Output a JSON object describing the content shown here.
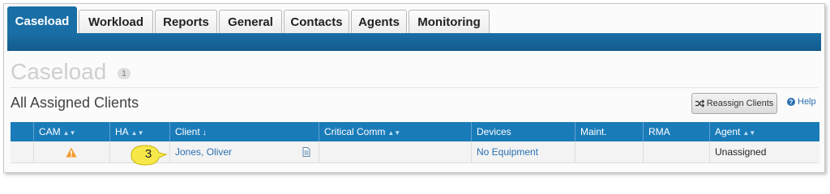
{
  "tabs": [
    {
      "label": "Caseload",
      "active": true
    },
    {
      "label": "Workload",
      "active": false
    },
    {
      "label": "Reports",
      "active": false
    },
    {
      "label": "General",
      "active": false
    },
    {
      "label": "Contacts",
      "active": false
    },
    {
      "label": "Agents",
      "active": false
    },
    {
      "label": "Monitoring",
      "active": false
    }
  ],
  "page": {
    "title": "Caseload",
    "count": "1"
  },
  "section": {
    "title": "All Assigned Clients"
  },
  "toolbar": {
    "reassign_label": "Reassign Clients",
    "help_label": "Help",
    "help_icon": "?"
  },
  "table": {
    "columns": [
      "CAM",
      "HA",
      "Client",
      "Critical Comm",
      "Devices",
      "Maint.",
      "RMA",
      "Agent"
    ],
    "rows": [
      {
        "cam_icon": "warning-icon",
        "ha": "",
        "client": "Jones, Oliver",
        "critical_comm": "",
        "devices": "No Equipment",
        "maint": "",
        "rma": "",
        "agent": "Unassigned"
      }
    ]
  },
  "callout": {
    "label": "3"
  },
  "colors": {
    "brand": "#1a6ea6",
    "header": "#1a7bb9",
    "link": "#2a6fb0",
    "warning": "#f29a2e",
    "callout": "#f7e84a"
  }
}
